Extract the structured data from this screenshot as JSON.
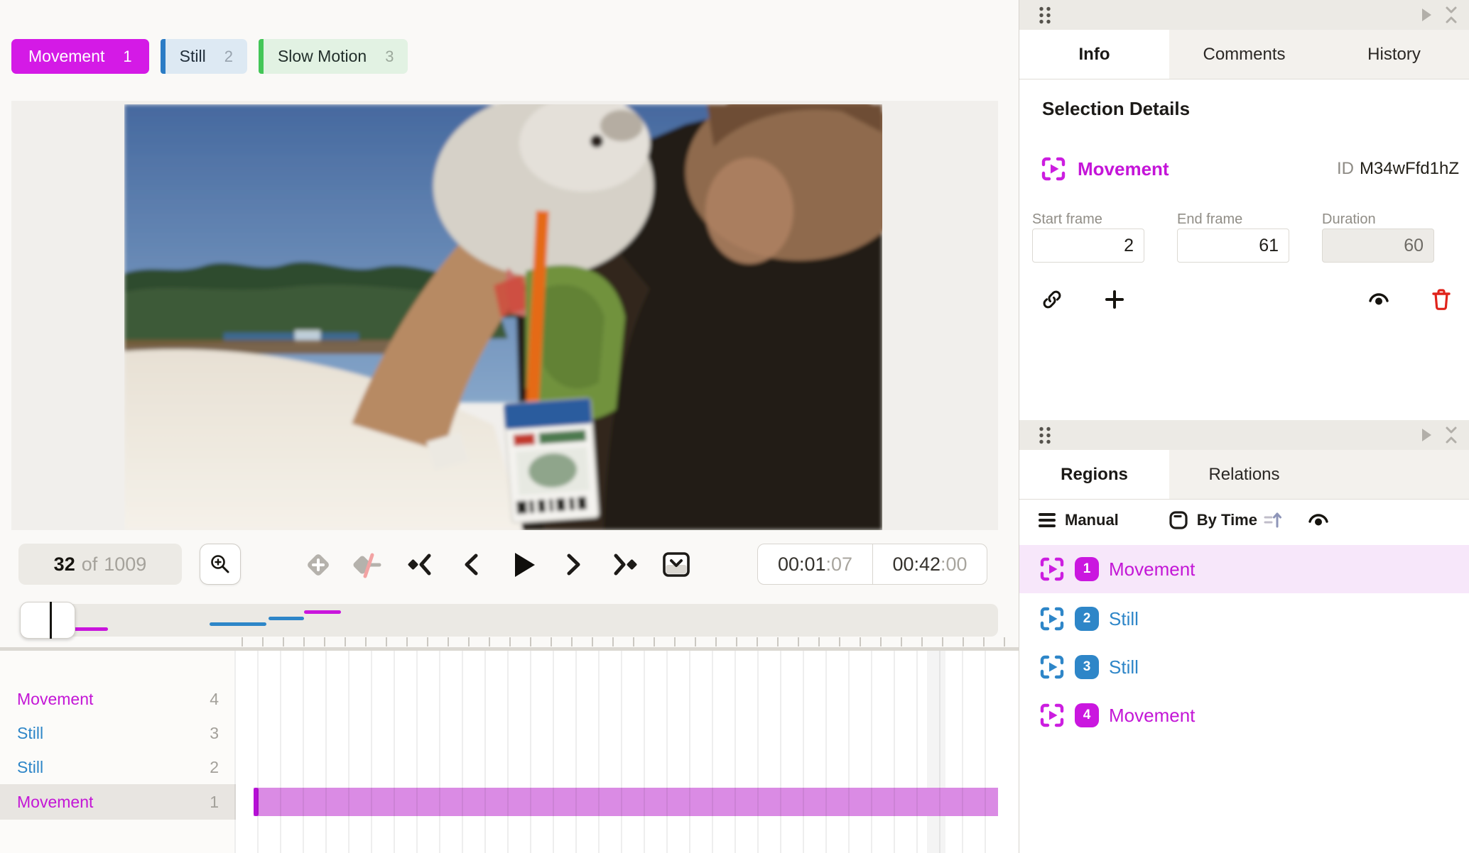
{
  "tags": [
    {
      "label": "Movement",
      "num": "1"
    },
    {
      "label": "Still",
      "num": "2"
    },
    {
      "label": "Slow Motion",
      "num": "3"
    }
  ],
  "player": {
    "frame_current": "32",
    "frame_of": "of",
    "frame_total": "1009",
    "time_current_main": "00:01",
    "time_current_sub": ":07",
    "time_total_main": "00:42",
    "time_total_sub": ":00"
  },
  "tracks": {
    "rows": [
      {
        "label": "Movement",
        "num": "4",
        "color": "magenta"
      },
      {
        "label": "Still",
        "num": "3",
        "color": "blue"
      },
      {
        "label": "Still",
        "num": "2",
        "color": "blue"
      },
      {
        "label": "Movement",
        "num": "1",
        "color": "magenta",
        "selected": true
      }
    ]
  },
  "panel_info": {
    "tabs": [
      "Info",
      "Comments",
      "History"
    ],
    "heading": "Selection Details",
    "selection": {
      "label": "Movement",
      "id_label": "ID",
      "id": "M34wFfd1hZ"
    },
    "fields": [
      {
        "label": "Start frame",
        "value": "2"
      },
      {
        "label": "End frame",
        "value": "61"
      },
      {
        "label": "Duration",
        "value": "60",
        "disabled": true
      }
    ]
  },
  "panel_regions": {
    "tabs": [
      "Regions",
      "Relations"
    ],
    "filter": {
      "manual": "Manual",
      "by_time": "By Time"
    },
    "rows": [
      {
        "num": "1",
        "label": "Movement",
        "color": "magenta",
        "selected": true
      },
      {
        "num": "2",
        "label": "Still",
        "color": "blue"
      },
      {
        "num": "3",
        "label": "Still",
        "color": "blue"
      },
      {
        "num": "4",
        "label": "Movement",
        "color": "magenta"
      }
    ]
  },
  "colors": {
    "magenta": "#ca17df",
    "magenta_bar_light": "#da8be4",
    "blue": "#2e86c8",
    "green": "#43c657",
    "selected_row_pink": "#f7e7fa",
    "danger_red": "#e0231b",
    "panel_header_gray": "#eceae5"
  }
}
